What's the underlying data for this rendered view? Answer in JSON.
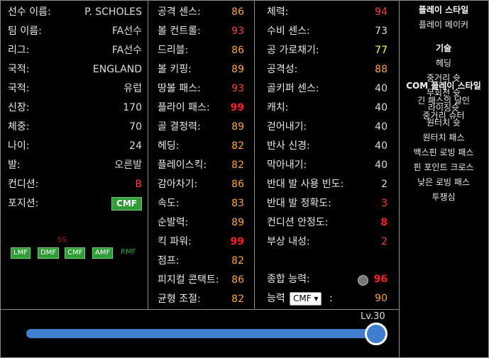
{
  "basic": [
    {
      "label": "선수 이름:",
      "value": "P. SCHOLES"
    },
    {
      "label": "팀 이름:",
      "value": "FA선수"
    },
    {
      "label": "리그:",
      "value": "FA선수"
    },
    {
      "label": "국적:",
      "value": "ENGLAND"
    },
    {
      "label": "국적:",
      "value": "유럽"
    },
    {
      "label": "신장:",
      "value": "170"
    },
    {
      "label": "체중:",
      "value": "70"
    },
    {
      "label": "나이:",
      "value": "24"
    },
    {
      "label": "발:",
      "value": "오른발"
    },
    {
      "label": "컨디션:",
      "value": "B"
    },
    {
      "label": "포지션:",
      "value": "CMF"
    }
  ],
  "positions": {
    "top_label": "SS",
    "boxes": [
      "LMF",
      "DMF",
      "CMF",
      "AMF"
    ],
    "plain": "RMF"
  },
  "col2": [
    {
      "label": "공격 센스:",
      "value": "86"
    },
    {
      "label": "볼 컨트롤:",
      "value": "93"
    },
    {
      "label": "드리블:",
      "value": "86"
    },
    {
      "label": "볼 키핑:",
      "value": "89"
    },
    {
      "label": "땅볼 패스:",
      "value": "93"
    },
    {
      "label": "플라이 패스:",
      "value": "99"
    },
    {
      "label": "골 결정력:",
      "value": "89"
    },
    {
      "label": "헤딩:",
      "value": "82"
    },
    {
      "label": "플레이스킥:",
      "value": "82"
    },
    {
      "label": "감아차기:",
      "value": "86"
    },
    {
      "label": "속도:",
      "value": "83"
    },
    {
      "label": "순발력:",
      "value": "89"
    },
    {
      "label": "킥 파워:",
      "value": "99"
    },
    {
      "label": "점프:",
      "value": "82"
    },
    {
      "label": "피지컬 콘택트:",
      "value": "86"
    },
    {
      "label": "균형 조절:",
      "value": "82"
    }
  ],
  "col3": [
    {
      "label": "체력:",
      "value": "94"
    },
    {
      "label": "수비 센스:",
      "value": "73"
    },
    {
      "label": "공 가로채기:",
      "value": "77"
    },
    {
      "label": "공격성:",
      "value": "88"
    },
    {
      "label": "골키퍼 센스:",
      "value": "40"
    },
    {
      "label": "캐치:",
      "value": "40"
    },
    {
      "label": "걷어내기:",
      "value": "40"
    },
    {
      "label": "반사 신경:",
      "value": "40"
    },
    {
      "label": "막아내기:",
      "value": "40"
    },
    {
      "label": "반대 발 사용 빈도:",
      "value": "2"
    },
    {
      "label": "반대 발 정확도:",
      "value": "3"
    },
    {
      "label": "컨디션 안정도:",
      "value": "8"
    },
    {
      "label": "부상 내성:",
      "value": "2"
    }
  ],
  "overall": {
    "label": "종합 능력:",
    "value": "96"
  },
  "ability": {
    "label": "능력",
    "select": "CMF",
    "value": "90"
  },
  "level": {
    "label": "Lv.30",
    "fraction": 1.0
  },
  "sidebar": {
    "playstyle_title": "플레이 스타일",
    "playstyle": "플레이 메이커",
    "skills_title": "기술",
    "skills": [
      "헤딩",
      "중거리 슛",
      "무회전 슛",
      "라이징슛",
      "원터치 슛",
      "원터치 패스",
      "백스핀 로빙 패스",
      "핀 포인트 크로스",
      "낮은 로빙 패스",
      "투쟁심"
    ],
    "com_title": "COM 플레이 스타일",
    "com": [
      "긴 패스의 달인",
      "중거리 슈터"
    ]
  },
  "colors": {
    "green": "#2f9d36",
    "blue": "#3f7fd0",
    "orange": "#ffa335",
    "red": "#ff3a3a"
  }
}
